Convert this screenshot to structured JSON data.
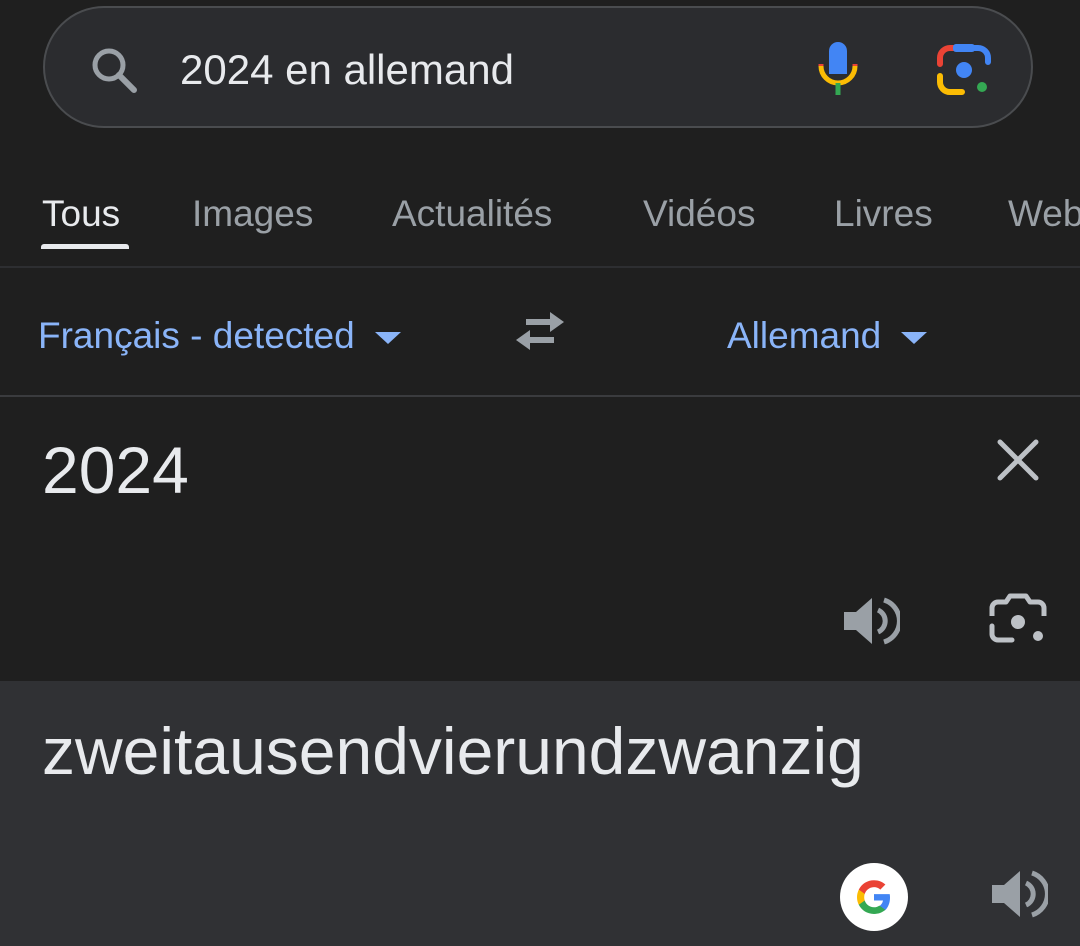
{
  "search": {
    "query": "2024 en allemand",
    "search_icon": "search-icon",
    "mic_icon": "microphone-icon",
    "lens_icon": "google-lens-icon"
  },
  "tabs": [
    {
      "label": "Tous",
      "active": true
    },
    {
      "label": "Images",
      "active": false
    },
    {
      "label": "Actualités",
      "active": false
    },
    {
      "label": "Vidéos",
      "active": false
    },
    {
      "label": "Livres",
      "active": false
    },
    {
      "label": "Web",
      "active": false
    }
  ],
  "translator": {
    "source_language": "Français - detected",
    "target_language": "Allemand",
    "swap_icon": "swap-languages-icon",
    "source_text": "2024",
    "translated_text": "zweitausendvierundzwanzig",
    "icons": {
      "clear": "close-icon",
      "source_speaker": "speaker-icon",
      "source_camera": "camera-translate-icon",
      "google": "google-g-icon",
      "target_speaker": "speaker-icon"
    }
  },
  "colors": {
    "background": "#1f1f1f",
    "search_bar": "#2b2c2f",
    "target_panel": "#303134",
    "link_blue": "#8ab4f8",
    "text_primary": "#e8eaed",
    "text_secondary": "#9aa0a6"
  }
}
